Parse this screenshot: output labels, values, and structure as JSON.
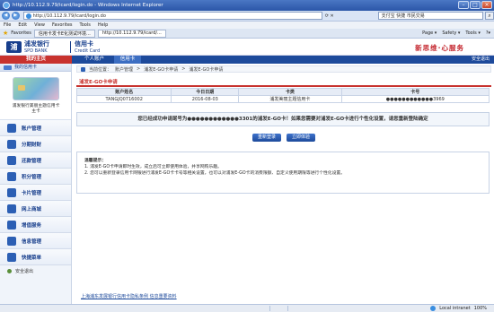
{
  "window": {
    "title": "http://10.112.9.79/icard/login.do - Windows Internet Explorer",
    "url": "http://10.112.9.79/icard/login.do",
    "search_placeholder": "支付宝 快捷 市民交易",
    "menu": [
      "File",
      "Edit",
      "View",
      "Favorites",
      "Tools",
      "Help"
    ],
    "favorites_label": "Favorites",
    "tabs": [
      "信用卡发卡E化测试环境...",
      "http://10.112.9.79/icard/..."
    ],
    "toolbar": [
      "Page ▾",
      "Safety ▾",
      "Tools ▾",
      "?▾"
    ],
    "status_zone": "Local intranet",
    "zoom": "100%"
  },
  "header": {
    "bank_name": "浦发银行",
    "bank_name_en": "SPD BANK",
    "product": "信用卡",
    "product_en": "Credit Card",
    "slogan": "新思维·心服务"
  },
  "nav": {
    "home": "我的主页",
    "personal": "个人账户",
    "card": "信用卡",
    "logout": "安全退出"
  },
  "sidebar": {
    "my_card_title": "我的信用卡",
    "card_caption": "浦发银行美丽主题信用卡\n主卡",
    "items": [
      {
        "label": "账户管理",
        "icon": "account-icon"
      },
      {
        "label": "分期财财",
        "icon": "installment-icon"
      },
      {
        "label": "还款管理",
        "icon": "repayment-icon"
      },
      {
        "label": "积分管理",
        "icon": "points-icon"
      },
      {
        "label": "卡片管理",
        "icon": "card-icon"
      },
      {
        "label": "网上商城",
        "icon": "mall-icon"
      },
      {
        "label": "增值服务",
        "icon": "service-icon"
      },
      {
        "label": "信息管理",
        "icon": "info-icon"
      },
      {
        "label": "快捷菜单",
        "icon": "shortcut-icon"
      }
    ],
    "safe_exit": "安全退出"
  },
  "main": {
    "breadcrumb": [
      "当前位置：",
      "账户管理",
      "浦发E-GO卡申请",
      "浦发E-GO卡申请"
    ],
    "section_title": "浦发E-GO卡申请",
    "table": {
      "headers": [
        "账户姓名",
        "今日日期",
        "卡类",
        "卡号"
      ],
      "row": [
        "TANGJQ0716002",
        "2016-08-03",
        "浦发美丽主题信用卡",
        "●●●●●●●●●●●●3969"
      ]
    },
    "notice": "您已经成功申请尾号为●●●●●●●●●●●●3301的浦发E-GO卡！如果您需要对浦发E-GO卡进行个性化设置，请您重新登陆确定",
    "buttons": [
      "重新登录",
      "立即体验"
    ],
    "tips_title": "温馨提示：",
    "tips": [
      "1. 浦发E-GO卡申请即时生效，成立后可立即使用体验，并享网购乐趣。",
      "2. 您可以重新登录信用卡网银进行浦发E-GO卡卡号等相关设置，也可以对浦发E-GO卡的消费限额、自定义使用期限等进行个性化设置。"
    ],
    "footer_link": "上海浦东发展银行信用卡隐私条例  信息重要资料"
  }
}
